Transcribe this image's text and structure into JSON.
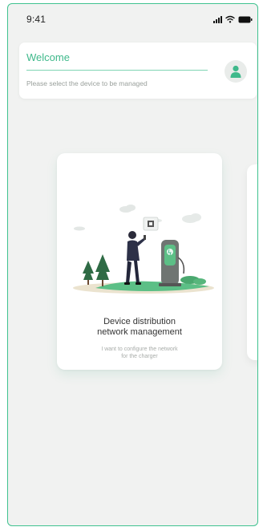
{
  "status_bar": {
    "time": "9:41",
    "icons": [
      "signal-icon",
      "wifi-icon",
      "battery-icon"
    ]
  },
  "header": {
    "title": "Welcome",
    "subtitle": "Please select the device to be managed",
    "avatar_icon": "user-icon"
  },
  "cards": [
    {
      "title_lines": [
        "Device distribution",
        "network management"
      ],
      "description_lines": [
        "I want to configure the network",
        "for the charger"
      ],
      "illustration": "person-configuring-charger-illustration"
    }
  ],
  "colors": {
    "accent": "#3fb98b",
    "background": "#f1f2f1",
    "card": "#ffffff"
  }
}
